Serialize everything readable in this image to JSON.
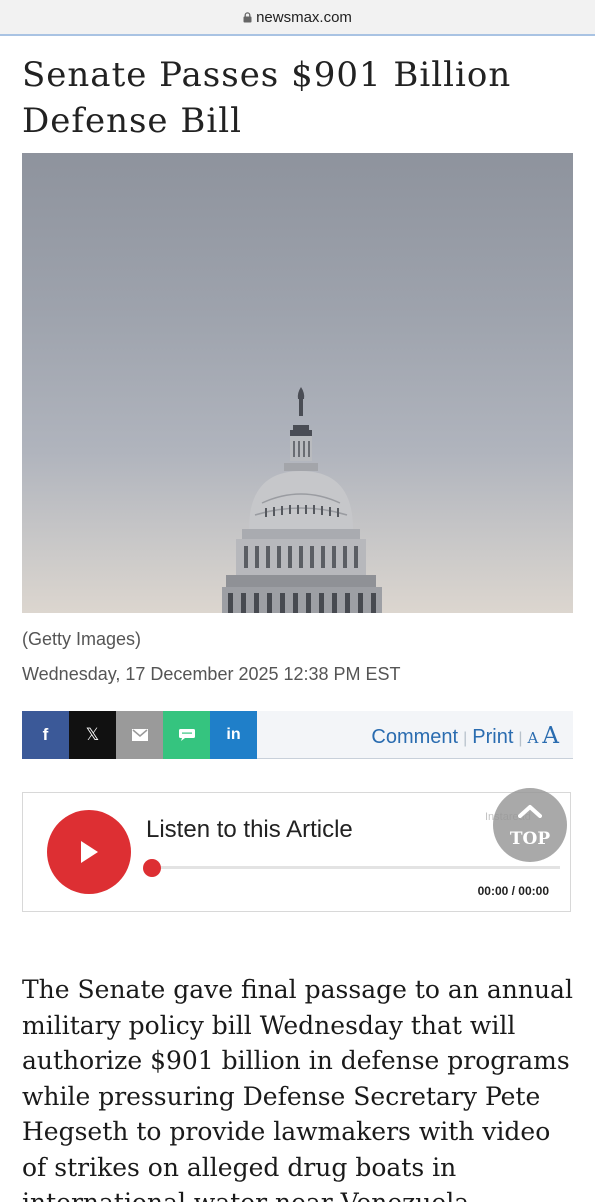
{
  "browser": {
    "url": "newsmax.com"
  },
  "article": {
    "headline": "Senate Passes $901 Billion Defense Bill",
    "image_credit": "(Getty Images)",
    "date": "Wednesday, 17 December 2025 12:38 PM EST",
    "body": "The Senate gave final passage to an annual military policy bill Wednesday that will authorize $901 billion in defense programs while pressuring Defense Secretary Pete Hegseth to provide lawmakers with video of strikes on alleged drug boats in international water near Venezuela."
  },
  "share": {
    "facebook_glyph": "f",
    "x_glyph": "𝕏",
    "linkedin_glyph": "in",
    "comment_label": "Comment",
    "print_label": "Print",
    "font_small_label": "A",
    "font_large_label": "A",
    "icons": [
      "facebook-icon",
      "x-icon",
      "email-icon",
      "sms-icon",
      "linkedin-icon"
    ],
    "colors": {
      "facebook": "#3b5998",
      "x": "#111111",
      "email": "#9a9a9a",
      "sms": "#35c47f",
      "linkedin": "#1f7fc9"
    }
  },
  "audio_player": {
    "title": "Listen to this Article",
    "time": "00:00 / 00:00",
    "brand": "Instaread",
    "progress": 0,
    "accent_color": "#dd2f33"
  },
  "back_to_top": {
    "label": "TOP"
  }
}
